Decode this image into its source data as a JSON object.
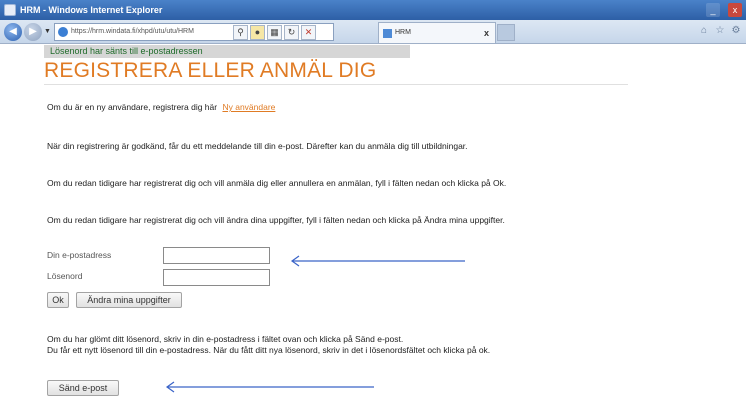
{
  "window": {
    "title": "HRM - Windows Internet Explorer",
    "minimize_glyph": "_",
    "close_glyph": "x"
  },
  "nav": {
    "address": "https://hrm.windata.fi/xhpd/utu/utu/HRM",
    "tab_title": "HRM",
    "tab_close": "x"
  },
  "page": {
    "status_message": "Lösenord har sänts till e-postadressen",
    "title": "REGISTRERA ELLER ANMÄL DIG",
    "new_user_text": "Om du är en ny användare, registrera dig här",
    "new_user_link": "Ny användare",
    "approval_text": "När din registrering är godkänd, får du ett meddelande till din e-post. Därefter kan du anmäla dig till utbildningar.",
    "enroll_text": "Om du redan tidigare har registrerat dig och vill anmäla dig eller annullera en anmälan, fyll i fälten nedan och klicka på Ok.",
    "change_text": "Om du redan tidigare har registrerat dig och vill ändra dina uppgifter, fyll i fälten nedan och klicka på Ändra mina uppgifter.",
    "form": {
      "email_label": "Din e-postadress",
      "email_value": "",
      "password_label": "Lösenord",
      "password_value": "",
      "ok_button": "Ok",
      "change_button": "Ändra mina uppgifter"
    },
    "forgot_line1": "Om du har glömt ditt lösenord, skriv in din e-postadress i fältet ovan och klicka på Sänd e-post.",
    "forgot_line2": "Du får ett nytt lösenord till din e-postadress. När du fått ditt nya lösenord, skriv in det i lösenordsfältet och klicka på ok.",
    "send_button": "Sänd e-post"
  },
  "colors": {
    "accent_orange": "#e07b24",
    "status_green": "#1f6b2a",
    "arrow_blue": "#3a63c8"
  }
}
